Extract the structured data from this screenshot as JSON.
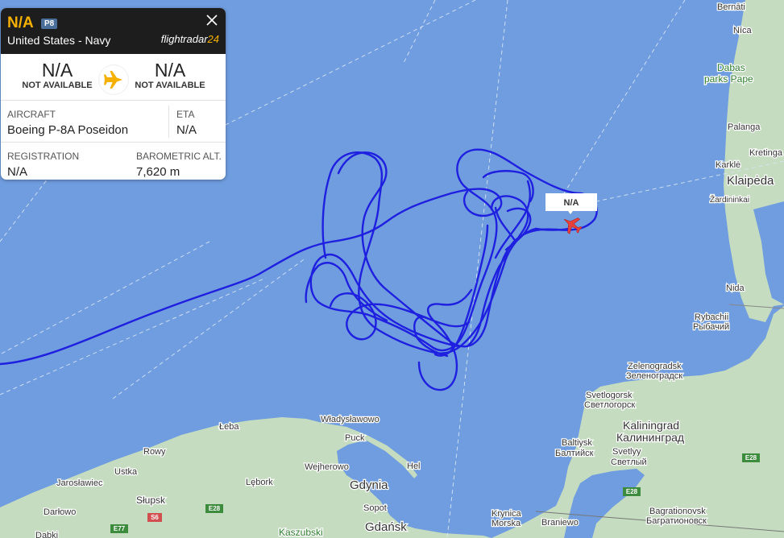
{
  "panel": {
    "flight_id": "N/A",
    "type_badge": "P8",
    "operator": "United States - Navy",
    "brand_text": "flightradar",
    "brand_num": "24",
    "origin_code": "N/A",
    "origin_label": "NOT AVAILABLE",
    "dest_code": "N/A",
    "dest_label": "NOT AVAILABLE",
    "aircraft_label": "AIRCRAFT",
    "aircraft_value": "Boeing P-8A Poseidon",
    "eta_label": "ETA",
    "eta_value": "N/A",
    "registration_label": "REGISTRATION",
    "registration_value": "N/A",
    "baro_label": "BAROMETRIC ALT.",
    "baro_value": "7,620 m"
  },
  "aircraft_marker": {
    "label": "N/A"
  },
  "colors": {
    "water": "#6f9ddf",
    "land": "#c5dcc0",
    "track": "#1f1fe0",
    "accent": "#f5b000",
    "aircraft": "#e8413c"
  },
  "places": {
    "berna": "Bernāti",
    "nica": "Nīca",
    "dabas1": "Dabas",
    "dabas2": "parks Pape",
    "palanga": "Palanga",
    "kretinga": "Kretinga",
    "karkle": "Karklė",
    "klaipeda": "Klaipėda",
    "zardininkai": "Žardininkai",
    "nida": "Nida",
    "rybachii": "Rybachii",
    "rybachii_ru": "Рыбачий",
    "zelenogradsk": "Zelenogradsk",
    "zelenogradsk_ru": "Зеленоградск",
    "svetlogorsk": "Svetlogorsk",
    "svetlogorsk_ru": "Светлогорск",
    "kaliningrad": "Kaliningrad",
    "kaliningrad_ru": "Калининград",
    "baltiysk": "Baltiysk",
    "baltiysk_ru": "Балтийск",
    "svetly": "Svetlyy",
    "svetly_ru": "Светлый",
    "bagrationovsk": "Bagrationovsk",
    "bagrationovsk_ru": "Багратионовск",
    "braniewo": "Braniewo",
    "krynica": "Krynica",
    "morska": "Morska",
    "leba": "Łeba",
    "wladyslawowo": "Władysławowo",
    "puck": "Puck",
    "hel": "Hel",
    "rowy": "Rowy",
    "ustka": "Ustka",
    "jaroslawiec": "Jarosławiec",
    "wejherowo": "Wejherowo",
    "lebork": "Lębork",
    "gdynia": "Gdynia",
    "slupsk": "Słupsk",
    "darlowo": "Darłowo",
    "sopot": "Sopot",
    "gdansk": "Gdańsk",
    "kaszubski": "Kaszubski",
    "dabki": "Dąbki"
  },
  "roads": {
    "e28a": "E28",
    "e28b": "E28",
    "e28c": "E28",
    "s6": "S6",
    "e77": "E77"
  }
}
